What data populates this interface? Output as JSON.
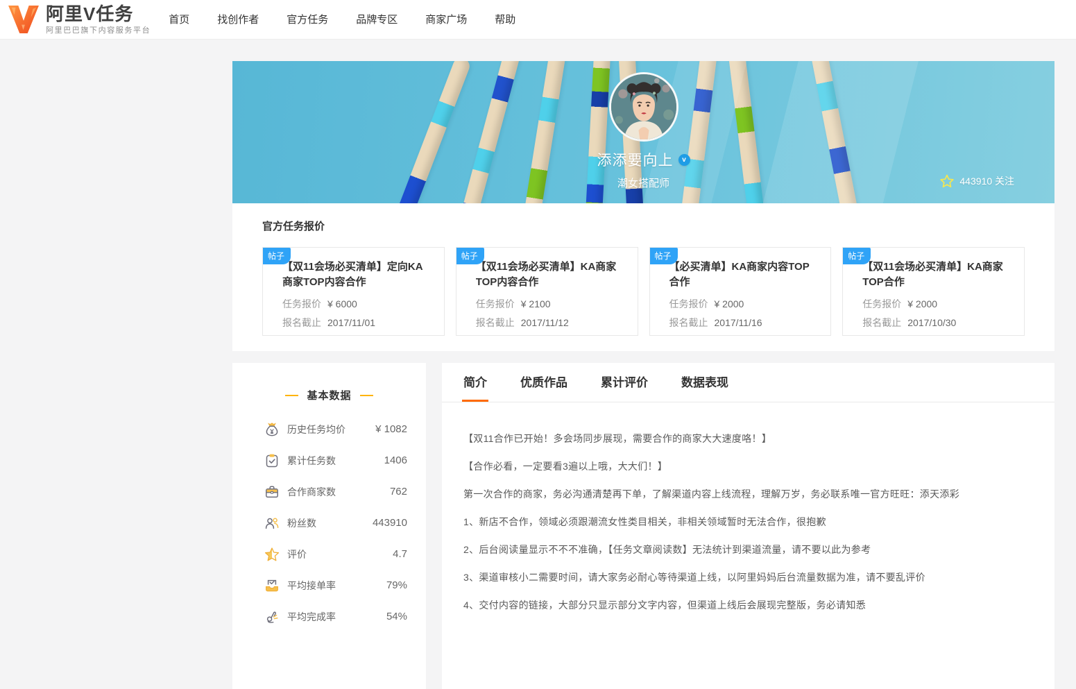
{
  "header": {
    "brand": "阿里V任务",
    "brand_subtitle": "阿里巴巴旗下内容服务平台",
    "nav": [
      {
        "label": "首页"
      },
      {
        "label": "找创作者"
      },
      {
        "label": "官方任务"
      },
      {
        "label": "品牌专区"
      },
      {
        "label": "商家广场"
      },
      {
        "label": "帮助"
      }
    ]
  },
  "profile": {
    "name": "添添要向上",
    "role": "潮女搭配师",
    "follow_count": "443910",
    "follow_label": "关注"
  },
  "tasks": {
    "section_title": "官方任务报价",
    "cards": [
      {
        "tag": "帖子",
        "title": "【双11会场必买清单】定向KA商家TOP内容合作",
        "price_label": "任务报价",
        "price": "¥ 6000",
        "deadline_label": "报名截止",
        "deadline": "2017/11/01"
      },
      {
        "tag": "帖子",
        "title": "【双11会场必买清单】KA商家TOP内容合作",
        "price_label": "任务报价",
        "price": "¥ 2100",
        "deadline_label": "报名截止",
        "deadline": "2017/11/12"
      },
      {
        "tag": "帖子",
        "title": "【必买清单】KA商家内容TOP合作",
        "price_label": "任务报价",
        "price": "¥ 2000",
        "deadline_label": "报名截止",
        "deadline": "2017/11/16"
      },
      {
        "tag": "帖子",
        "title": "【双11会场必买清单】KA商家TOP合作",
        "price_label": "任务报价",
        "price": "¥ 2000",
        "deadline_label": "报名截止",
        "deadline": "2017/10/30"
      }
    ]
  },
  "stats": {
    "section_title": "基本数据",
    "items": [
      {
        "icon": "money-bag-icon",
        "label": "历史任务均价",
        "value": "¥ 1082"
      },
      {
        "icon": "clipboard-check-icon",
        "label": "累计任务数",
        "value": "1406"
      },
      {
        "icon": "briefcase-icon",
        "label": "合作商家数",
        "value": "762"
      },
      {
        "icon": "users-icon",
        "label": "粉丝数",
        "value": "443910"
      },
      {
        "icon": "star-icon",
        "label": "评价",
        "value": "4.7"
      },
      {
        "icon": "inbox-check-icon",
        "label": "平均接单率",
        "value": "79%"
      },
      {
        "icon": "hand-ok-icon",
        "label": "平均完成率",
        "value": "54%"
      }
    ]
  },
  "main": {
    "tabs": [
      {
        "label": "简介",
        "active": true
      },
      {
        "label": "优质作品",
        "active": false
      },
      {
        "label": "累计评价",
        "active": false
      },
      {
        "label": "数据表现",
        "active": false
      }
    ],
    "paragraphs": [
      "【双11合作已开始！多会场同步展现，需要合作的商家大大速度咯！】",
      "【合作必看，一定要看3遍以上哦，大大们！】",
      "第一次合作的商家，务必沟通清楚再下单，了解渠道内容上线流程，理解万岁，务必联系唯一官方旺旺：添天添彩",
      "1、新店不合作，领域必须跟潮流女性类目相关，非相关领域暂时无法合作，很抱歉",
      "2、后台阅读量显示不不不准确，【任务文章阅读数】无法统计到渠道流量，请不要以此为参考",
      "3、渠道审核小二需要时间，请大家务必耐心等待渠道上线，以阿里妈妈后台流量数据为准，请不要乱评价",
      "4、交付内容的链接，大部分只显示部分文字内容，但渠道上线后会展现完整版，务必请知悉"
    ]
  },
  "colors": {
    "accent_orange": "#ff6a00",
    "tag_blue": "#2fa3f7",
    "banner_blue": "#5bb9d8",
    "heading_dash_yellow": "#ffb400",
    "icon_yellow": "#f5bf4d",
    "star_yellow": "#f6e74f",
    "logo_orange": "#f9692c"
  }
}
